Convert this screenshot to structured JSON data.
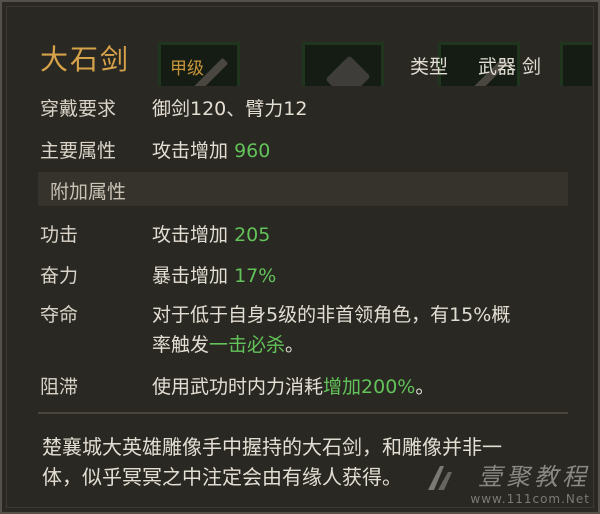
{
  "item": {
    "name": "大石剑",
    "grade": "甲级",
    "type_label": "类型",
    "type_value": "武器 剑"
  },
  "rows": {
    "requirement": {
      "key": "穿戴要求",
      "value": "御剑120、臂力12"
    },
    "main_attr": {
      "key": "主要属性",
      "value_text": "攻击增加",
      "value_num": "960"
    }
  },
  "section": {
    "additional": "附加属性"
  },
  "additional": {
    "gongji": {
      "key": "功击",
      "value_text": "攻击增加",
      "value_num": "205"
    },
    "fenli": {
      "key": "奋力",
      "value_text": "暴击增加",
      "value_num": "17%"
    },
    "duoming": {
      "key": "夺命",
      "line1": "对于低于自身5级的非首领角色，有15%概",
      "line2_plain": "率触发",
      "line2_green": "一击必杀",
      "line2_end": "。"
    },
    "zhizhi": {
      "key": "阻滞",
      "value_plain": "使用武功时内力消耗",
      "value_green": "增加200%",
      "value_end": "。"
    }
  },
  "flavor": {
    "line1": "楚襄城大英雄雕像手中握持的大石剑，和雕像并非一",
    "line2": "体，似乎冥冥之中注定会由有缘人获得。"
  },
  "watermark": {
    "text": "壹聚教程",
    "url": "www.111com.Net"
  },
  "colors": {
    "title": "#d6a24a",
    "positive": "#62c35a",
    "panel": "#2a2822"
  }
}
